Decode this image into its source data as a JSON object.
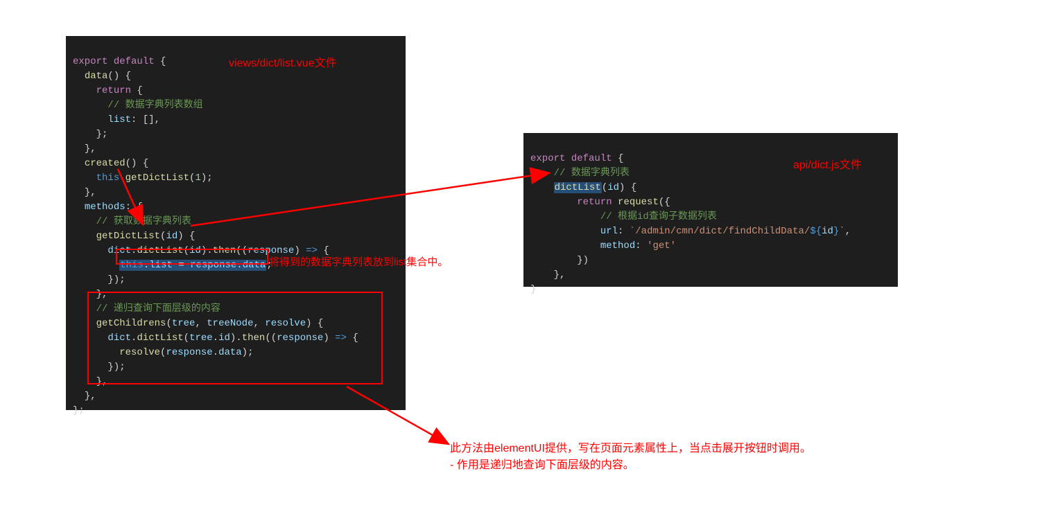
{
  "left_label": "views/dict/list.vue文件",
  "right_label": "api/dict.js文件",
  "anno_list": "将得到的数据字典列表放到list集合中。",
  "anno_bottom_l1": "此方法由elementUI提供，写在页面元素属性上，当点击展开按钮时调用。",
  "anno_bottom_l2": "- 作用是递归地查询下面层级的内容。",
  "left_code": {
    "l1_a": "export",
    "l1_b": "default",
    "l1_c": " {",
    "l2_a": "data",
    "l2_b": "() {",
    "l3_a": "return",
    "l3_b": " {",
    "l4": "// 数据字典列表数组",
    "l5_a": "list",
    "l5_b": ": [],",
    "l6": "};",
    "l7": "},",
    "l8_a": "created",
    "l8_b": "() {",
    "l9_a": "this",
    "l9_b": ".",
    "l9_c": "getDictList",
    "l9_d": "(",
    "l9_e": "1",
    "l9_f": ");",
    "l10": "},",
    "l11_a": "methods",
    "l11_b": ": {",
    "l12": "// 获取数据字典列表",
    "l13_a": "getDictList",
    "l13_b": "(",
    "l13_c": "id",
    "l13_d": ") {",
    "l14_a": "dict",
    "l14_b": ".",
    "l14_c": "dictList",
    "l14_d": "(",
    "l14_e": "id",
    "l14_f": ").",
    "l14_g": "then",
    "l14_h": "((",
    "l14_i": "response",
    "l14_j": ") ",
    "l14_k": "=>",
    "l14_l": " {",
    "l15_a": "this",
    "l15_b": ".",
    "l15_c": "list",
    "l15_d": " = ",
    "l15_e": "response",
    "l15_f": ".",
    "l15_g": "data",
    "l15_h": ";",
    "l16": "});",
    "l17": "},",
    "l18": "// 递归查询下面层级的内容",
    "l19_a": "getChildrens",
    "l19_b": "(",
    "l19_c": "tree",
    "l19_d": ", ",
    "l19_e": "treeNode",
    "l19_f": ", ",
    "l19_g": "resolve",
    "l19_h": ") {",
    "l20_a": "dict",
    "l20_b": ".",
    "l20_c": "dictList",
    "l20_d": "(",
    "l20_e": "tree",
    "l20_f": ".",
    "l20_g": "id",
    "l20_h": ").",
    "l20_i": "then",
    "l20_j": "((",
    "l20_k": "response",
    "l20_l": ") ",
    "l20_m": "=>",
    "l20_n": " {",
    "l21_a": "resolve",
    "l21_b": "(",
    "l21_c": "response",
    "l21_d": ".",
    "l21_e": "data",
    "l21_f": ");",
    "l22": "});",
    "l23": "},",
    "l24": "},",
    "l25": "};"
  },
  "right_code": {
    "r1_a": "export",
    "r1_b": "default",
    "r1_c": " {",
    "r2": "// 数据字典列表",
    "r3_a": "dictList",
    "r3_b": "(",
    "r3_c": "id",
    "r3_d": ") {",
    "r4_a": "return",
    "r4_b": " ",
    "r4_c": "request",
    "r4_d": "({",
    "r5": "// 根据id查询子数据列表",
    "r6_a": "url",
    "r6_b": ": ",
    "r6_c": "`/admin/cmn/dict/findChildData/",
    "r6_d": "${",
    "r6_e": "id",
    "r6_f": "}",
    "r6_g": "`",
    "r6_h": ",",
    "r7_a": "method",
    "r7_b": ": ",
    "r7_c": "'get'",
    "r8": "})",
    "r9": "},",
    "r10": "}"
  }
}
